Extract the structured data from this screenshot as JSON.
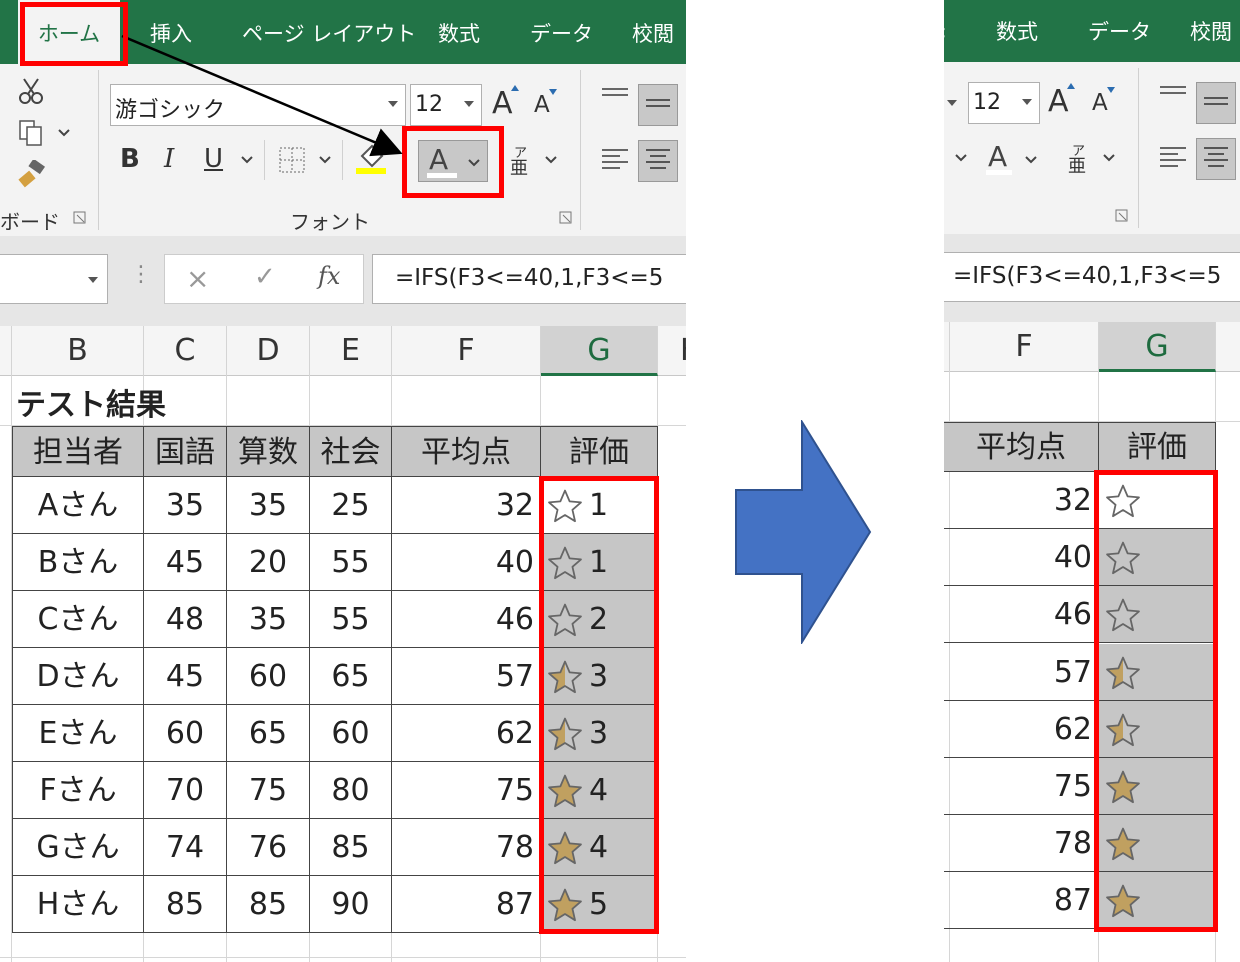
{
  "tabs_left": [
    "ホーム",
    "挿入",
    "ページ レイアウト",
    "数式",
    "データ",
    "校閲"
  ],
  "tabs_right": [
    "数式",
    "データ",
    "校閲"
  ],
  "ribbon": {
    "font_name": "游ゴシック",
    "font_size": "12",
    "group_font_label": "フォント",
    "group_clipboard_label": "ボード",
    "bold": "B",
    "italic": "I",
    "underline": "U",
    "grow_font": "A",
    "shrink_font": "A",
    "font_color_letter": "A",
    "phonetic_small": "ア",
    "phonetic_big": "亜"
  },
  "formula_bar": {
    "cancel": "×",
    "enter": "✓",
    "fx": "fx",
    "formula_left": "=IFS(F3<=40,1,F3<=5",
    "formula_right": "=IFS(F3<=40,1,F3<=5"
  },
  "columns_left": [
    "B",
    "C",
    "D",
    "E",
    "F",
    "G",
    "H"
  ],
  "columns_right": [
    "F",
    "G"
  ],
  "sheet": {
    "title": "テスト結果",
    "headers": [
      "担当者",
      "国語",
      "算数",
      "社会",
      "平均点",
      "評価"
    ],
    "rows": [
      [
        "Aさん",
        "35",
        "35",
        "25",
        "32",
        "1"
      ],
      [
        "Bさん",
        "45",
        "20",
        "55",
        "40",
        "1"
      ],
      [
        "Cさん",
        "48",
        "35",
        "55",
        "46",
        "2"
      ],
      [
        "Dさん",
        "45",
        "60",
        "65",
        "57",
        "3"
      ],
      [
        "Eさん",
        "60",
        "65",
        "60",
        "62",
        "3"
      ],
      [
        "Fさん",
        "70",
        "75",
        "80",
        "75",
        "4"
      ],
      [
        "Gさん",
        "74",
        "76",
        "85",
        "78",
        "4"
      ],
      [
        "Hさん",
        "85",
        "85",
        "90",
        "87",
        "5"
      ]
    ],
    "star_fill": [
      0,
      0,
      0,
      0.5,
      0.5,
      1,
      1,
      1
    ]
  },
  "colors": {
    "excel_green": "#227447",
    "highlight_red": "#ff0000",
    "arrow_blue": "#4472c4",
    "star_gold": "#c0a060",
    "cell_gray": "#c6c6c6"
  }
}
